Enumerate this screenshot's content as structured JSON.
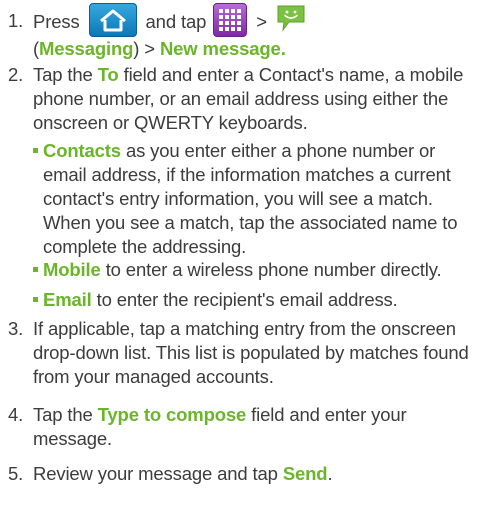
{
  "steps": [
    {
      "number": "1.",
      "parts": {
        "press": "Press",
        "and_tap": "and tap",
        "gt1": ">",
        "messaging": "Messaging",
        "paren_open": "(",
        "paren_close": ")",
        "gt2": ">",
        "new_message": "New message",
        "period": "."
      },
      "icons": [
        "home-icon",
        "apps-icon",
        "messaging-icon"
      ]
    },
    {
      "number": "2.",
      "parts": {
        "tap_the": "Tap the",
        "to": "To",
        "rest": "field and enter a Contact's name, a mobile phone number, or an email address using either the onscreen or QWERTY keyboards."
      }
    },
    {
      "number": "3.",
      "text": "If applicable, tap a matching entry from the onscreen drop-down list. This list is populated by matches found from your managed accounts."
    },
    {
      "number": "4.",
      "parts": {
        "tap_the": "Tap the",
        "type_to_compose": "Type to compose",
        "rest": "field and enter your message."
      }
    },
    {
      "number": "5.",
      "parts": {
        "lead": "Review your message and tap",
        "send": "Send",
        "period": "."
      }
    }
  ],
  "bullets": [
    {
      "term": "Contacts",
      "text": "as you enter either a phone number or email address, if the information matches a current contact's entry information, you will see a match. When you see a match, tap the associated name to complete the addressing."
    },
    {
      "term": "Mobile",
      "text": "to enter a wireless phone number directly."
    },
    {
      "term": "Email",
      "text": "to enter the recipient's email address."
    }
  ],
  "colors": {
    "accent_green": "#6ab52a",
    "body_text": "#3c3c3c",
    "home_button_blue": "#1f8fcc",
    "apps_button_purple": "#9a45c0",
    "messaging_green": "#7cc242"
  }
}
